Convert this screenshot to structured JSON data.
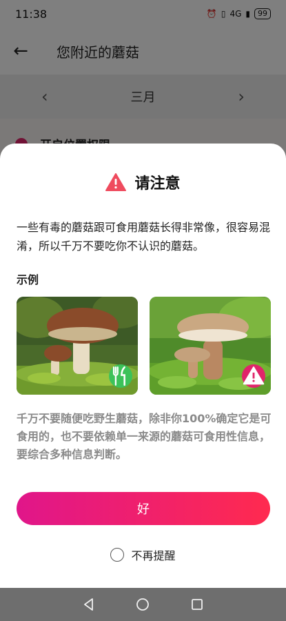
{
  "status_bar": {
    "time": "11:38",
    "signal": "4G",
    "battery": "99"
  },
  "header": {
    "title": "您附近的蘑菇"
  },
  "month_nav": {
    "month": "三月"
  },
  "background_list": {
    "item_label": "开启位置权限"
  },
  "dialog": {
    "title": "请注意",
    "intro": "一些有毒的蘑菇跟可食用蘑菇长得非常像，很容易混淆，所以千万不要吃你不认识的蘑菇。",
    "example_label": "示例",
    "images": [
      {
        "badge": "fork-knife-icon",
        "badge_color": "#3cc25a"
      },
      {
        "badge": "warning-icon",
        "badge_color": "#e0246a"
      }
    ],
    "warning": "千万不要随便吃野生蘑菇，除非你100%确定它是可食用的，也不要依赖单一来源的蘑菇可食用性信息，要综合多种信息判断。",
    "ok_label": "好",
    "no_remind_label": "不再提醒"
  },
  "colors": {
    "accent_start": "#e0168a",
    "accent_end": "#ff2a4f",
    "warning_red": "#ef4b5e"
  }
}
